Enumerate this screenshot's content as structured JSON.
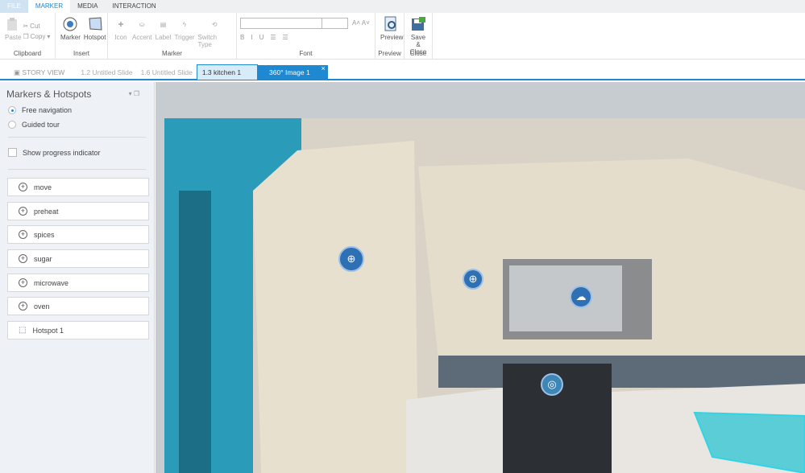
{
  "menu_tabs": [
    "FILE",
    "MARKER",
    "MEDIA",
    "INTERACTION"
  ],
  "ribbon": {
    "clipboard": {
      "label": "Clipboard",
      "paste": "Paste",
      "cut": "Cut",
      "copy": "Copy"
    },
    "insert": {
      "label": "Insert",
      "marker": "Marker",
      "hotspot": "Hotspot"
    },
    "marker": {
      "label": "Marker",
      "icon": "Icon",
      "accent": "Accent",
      "label_btn": "Label",
      "trigger": "Trigger",
      "switch_type": "Switch Type"
    },
    "font": {
      "label": "Font",
      "bold": "B",
      "italic": "I",
      "underline": "U"
    },
    "preview": {
      "label": "Preview",
      "button": "Preview"
    },
    "close": {
      "label": "Close",
      "button": "Save & Close"
    }
  },
  "doc_tabs": {
    "story_view": "STORY VIEW",
    "tabs": [
      "1.2 Untitled Slide",
      "1.6 Untitled Slide",
      "1.3 kitchen 1",
      "360° Image 1"
    ],
    "close": "×"
  },
  "panel": {
    "title": "Markers & Hotspots",
    "nav_options": [
      "Free navigation",
      "Guided tour"
    ],
    "selected_nav": "Free navigation",
    "progress": "Show progress indicator",
    "progress_checked": false,
    "items": [
      "move",
      "preheat",
      "spices",
      "sugar",
      "microwave",
      "oven",
      "Hotspot 1"
    ]
  }
}
